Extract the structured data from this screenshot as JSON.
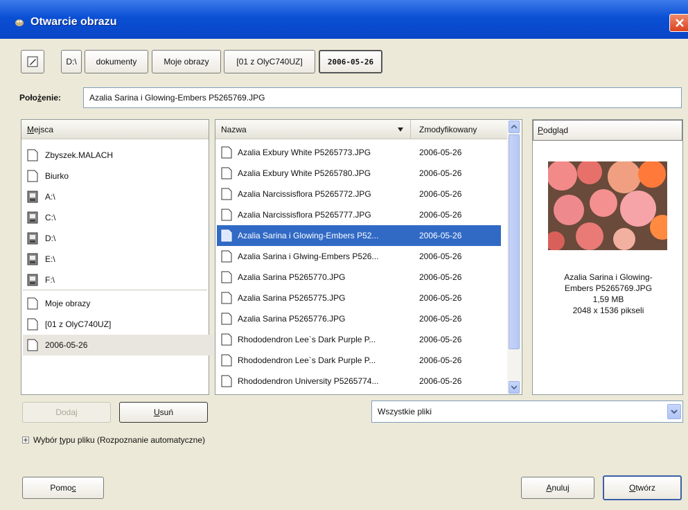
{
  "window": {
    "title": "Otwarcie obrazu"
  },
  "breadcrumb": {
    "items": [
      "D:\\",
      "dokumenty",
      "Moje obrazy",
      "[01 z OlyC740UZ]",
      "2006-05-26"
    ]
  },
  "location": {
    "label": "Położenie:",
    "value": "Azalia Sarina i Glowing-Embers P5265769.JPG"
  },
  "places": {
    "header": "Miejsca",
    "items": [
      {
        "label": "Zbyszek.MALACH",
        "icon": "folder-icon"
      },
      {
        "label": "Biurko",
        "icon": "folder-icon"
      },
      {
        "label": "A:\\",
        "icon": "drive-icon"
      },
      {
        "label": "C:\\",
        "icon": "drive-icon"
      },
      {
        "label": "D:\\",
        "icon": "drive-icon"
      },
      {
        "label": "E:\\",
        "icon": "drive-icon"
      },
      {
        "label": "F:\\",
        "icon": "drive-icon"
      },
      {
        "label": "Moje obrazy",
        "icon": "folder-icon"
      },
      {
        "label": "[01 z OlyC740UZ]",
        "icon": "folder-icon"
      },
      {
        "label": "2006-05-26",
        "icon": "folder-icon"
      }
    ]
  },
  "files": {
    "col_name": "Nazwa",
    "col_modified": "Zmodyfikowany",
    "rows": [
      {
        "name": "Azalia Exbury White P5265773.JPG",
        "date": "2006-05-26"
      },
      {
        "name": "Azalia Exbury White P5265780.JPG",
        "date": "2006-05-26"
      },
      {
        "name": "Azalia Narcissisflora P5265772.JPG",
        "date": "2006-05-26"
      },
      {
        "name": "Azalia Narcissisflora P5265777.JPG",
        "date": "2006-05-26"
      },
      {
        "name": "Azalia Sarina i Glowing-Embers P52...",
        "date": "2006-05-26"
      },
      {
        "name": "Azalia Sarina i Glwing-Embers P526...",
        "date": "2006-05-26"
      },
      {
        "name": "Azalia Sarina P5265770.JPG",
        "date": "2006-05-26"
      },
      {
        "name": "Azalia Sarina P5265775.JPG",
        "date": "2006-05-26"
      },
      {
        "name": "Azalia Sarina P5265776.JPG",
        "date": "2006-05-26"
      },
      {
        "name": "Rhododendron  Lee`s Dark Purple P...",
        "date": "2006-05-26"
      },
      {
        "name": "Rhododendron  Lee`s Dark Purple P...",
        "date": "2006-05-26"
      },
      {
        "name": "Rhododendron University P5265774...",
        "date": "2006-05-26"
      }
    ]
  },
  "preview": {
    "header": "Podgląd",
    "name_line1": "Azalia Sarina i Glowing-",
    "name_line2": "Embers P5265769.JPG",
    "size": "1,59 MB",
    "dimensions": "2048 x 1536 pikseli"
  },
  "buttons": {
    "add": "Dodaj",
    "remove": "Usuń",
    "help": "Pomoc",
    "cancel": "Anuluj",
    "open": "Otwórz"
  },
  "filter": {
    "selected": "Wszystkie pliki"
  },
  "filetype_expander": {
    "label": "Wybór typu pliku (Rozpoznanie automatyczne)"
  },
  "colors": {
    "selection": "#316ac5",
    "titlebar": "#0a4fd4",
    "dialog_bg": "#ece9d8"
  }
}
